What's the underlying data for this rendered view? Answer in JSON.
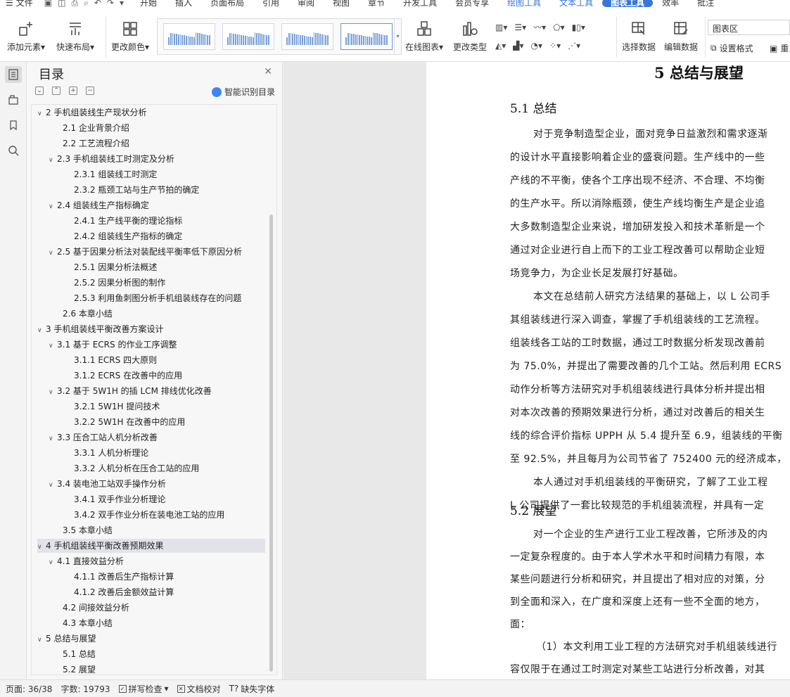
{
  "menubar": {
    "file_label": "文件",
    "tabs": [
      {
        "label": "开始"
      },
      {
        "label": "插入"
      },
      {
        "label": "页面布局"
      },
      {
        "label": "引用"
      },
      {
        "label": "审阅"
      },
      {
        "label": "视图"
      },
      {
        "label": "章节"
      },
      {
        "label": "开发工具"
      },
      {
        "label": "会员专享"
      },
      {
        "label": "绘图工具"
      },
      {
        "label": "文本工具"
      },
      {
        "label": "图表工具"
      },
      {
        "label": "效率"
      },
      {
        "label": "批注"
      }
    ],
    "highlight_tabs": [
      "绘图工具",
      "文本工具"
    ],
    "active_tab": "图表工具",
    "accent_color": "#3776d7"
  },
  "ribbon": {
    "add_element": "添加元素",
    "quick_layout": "快速布局",
    "change_color": "更改颜色",
    "online_chart": "在线图表",
    "change_type": "更改类型",
    "select_data": "选择数据",
    "edit_data": "编辑数据",
    "chart_area_combo": "图表区",
    "set_format": "设置格式",
    "reset_partial": "重"
  },
  "toc": {
    "title": "目录",
    "smart_label": "智能识别目录",
    "items": [
      {
        "text": "2  手机组装线生产现状分析",
        "level": 1,
        "expanded": true
      },
      {
        "text": "2.1  企业背景介绍",
        "level": 2
      },
      {
        "text": "2.2  工艺流程介绍",
        "level": 2
      },
      {
        "text": "2.3 手机组装线工时测定及分析",
        "level": 2,
        "expanded": true
      },
      {
        "text": "2.3.1  组装线工时测定",
        "level": 3
      },
      {
        "text": "2.3.2  瓶颈工站与生产节拍的确定",
        "level": 3
      },
      {
        "text": "2.4  组装线生产指标确定",
        "level": 2,
        "expanded": true
      },
      {
        "text": "2.4.1  生产线平衡的理论指标",
        "level": 3
      },
      {
        "text": "2.4.2  组装线生产指标的确定",
        "level": 3
      },
      {
        "text": "2.5  基于因果分析法对装配线平衡率低下原因分析",
        "level": 2,
        "expanded": true
      },
      {
        "text": "2.5.1  因果分析法概述",
        "level": 3
      },
      {
        "text": "2.5.2 因果分析图的制作",
        "level": 3
      },
      {
        "text": "2.5.3  利用鱼刺图分析手机组装线存在的问题",
        "level": 3
      },
      {
        "text": "2.6  本章小结",
        "level": 2
      },
      {
        "text": "3  手机组装线平衡改善方案设计",
        "level": 1,
        "expanded": true
      },
      {
        "text": "3.1  基于 ECRS 的作业工序调整",
        "level": 2,
        "expanded": true
      },
      {
        "text": "3.1.1 ECRS 四大原则",
        "level": 3
      },
      {
        "text": "3.1.2 ECRS 在改善中的应用",
        "level": 3
      },
      {
        "text": "3.2  基于 5W1H 的插 LCM 排线优化改善",
        "level": 2,
        "expanded": true
      },
      {
        "text": "3.2.1 5W1H 提问技术",
        "level": 3
      },
      {
        "text": "3.2.2 5W1H  在改善中的应用",
        "level": 3
      },
      {
        "text": "3.3  压合工站人机分析改善",
        "level": 2,
        "expanded": true
      },
      {
        "text": "3.3.1  人机分析理论",
        "level": 3
      },
      {
        "text": "3.3.2  人机分析在压合工站的应用",
        "level": 3
      },
      {
        "text": "3.4  装电池工站双手操作分析",
        "level": 2,
        "expanded": true
      },
      {
        "text": "3.4.1  双手作业分析理论",
        "level": 3
      },
      {
        "text": "3.4.2  双手作业分析在装电池工站的应用",
        "level": 3
      },
      {
        "text": "3.5  本章小结",
        "level": 2
      },
      {
        "text": "4  手机组装线平衡改善预期效果",
        "level": 1,
        "expanded": true,
        "selected": true
      },
      {
        "text": "4.1  直接效益分析",
        "level": 2,
        "expanded": true
      },
      {
        "text": "4.1.1  改善后生产指标计算",
        "level": 3
      },
      {
        "text": "4.1.2  改善后金额效益计算",
        "level": 3
      },
      {
        "text": "4.2  间接效益分析",
        "level": 2
      },
      {
        "text": "4.3  本章小结",
        "level": 2
      },
      {
        "text": "5  总结与展望",
        "level": 1,
        "expanded": true
      },
      {
        "text": "5.1 总结",
        "level": 2
      },
      {
        "text": "5.2  展望",
        "level": 2
      }
    ]
  },
  "document": {
    "chapter_title": "5  总结与展望",
    "sec1_title": "5.1 总结",
    "sec1_lines": [
      "对于竞争制造型企业，面对竞争日益激烈和需求逐渐",
      "的设计水平直接影响着企业的盛衰问题。生产线中的一些",
      "产线的不平衡，使各个工序出现不经济、不合理、不均衡",
      "的生产水平。所以消除瓶颈，使生产线均衡生产是企业追",
      "大多数制造型企业来说，增加研发投入和技术革新是一个",
      "通过对企业进行自上而下的工业工程改善可以帮助企业短",
      "场竞争力，为企业长足发展打好基础。",
      "本文在总结前人研究方法结果的基础上，以 L 公司手",
      "其组装线进行深入调查，掌握了手机组装线的工艺流程。",
      "组装线各工站的工时数据，通过工时数据分析发现改善前",
      "为 75.0%，并提出了需要改善的几个工站。然后利用 ECRS",
      "动作分析等方法研究对手机组装线进行具体分析并提出相",
      "对本次改善的预期效果进行分析，通过对改善后的相关生",
      "线的综合评价指标 UPPH 从 5.4 提升至 6.9，组装线的平衡",
      "至 92.5%，并且每月为公司节省了 752400 元的经济成本，",
      "本人通过对手机组装线的平衡研究，了解了工业工程",
      "L 公司提供了一套比较规范的手机组装流程，并具有一定"
    ],
    "sec2_title": "5.2  展望",
    "sec2_lines": [
      "对一个企业的生产进行工业工程改善，它所涉及的内",
      "一定复杂程度的。由于本人学术水平和时间精力有限，本",
      "某些问题进行分析和研究，并且提出了相对应的对策，分",
      "到全面和深入，在广度和深度上还有一些不全面的地方，",
      "面：",
      "（1）本文利用工业工程的方法研究对手机组装线进行",
      "容仅限于在通过工时测定对某些工站进行分析改善，对其"
    ]
  },
  "status": {
    "page": "页面: 36/38",
    "words": "字数: 19793",
    "spell": "拼写检查",
    "proof": "文档校对",
    "missing_font": "缺失字体"
  }
}
